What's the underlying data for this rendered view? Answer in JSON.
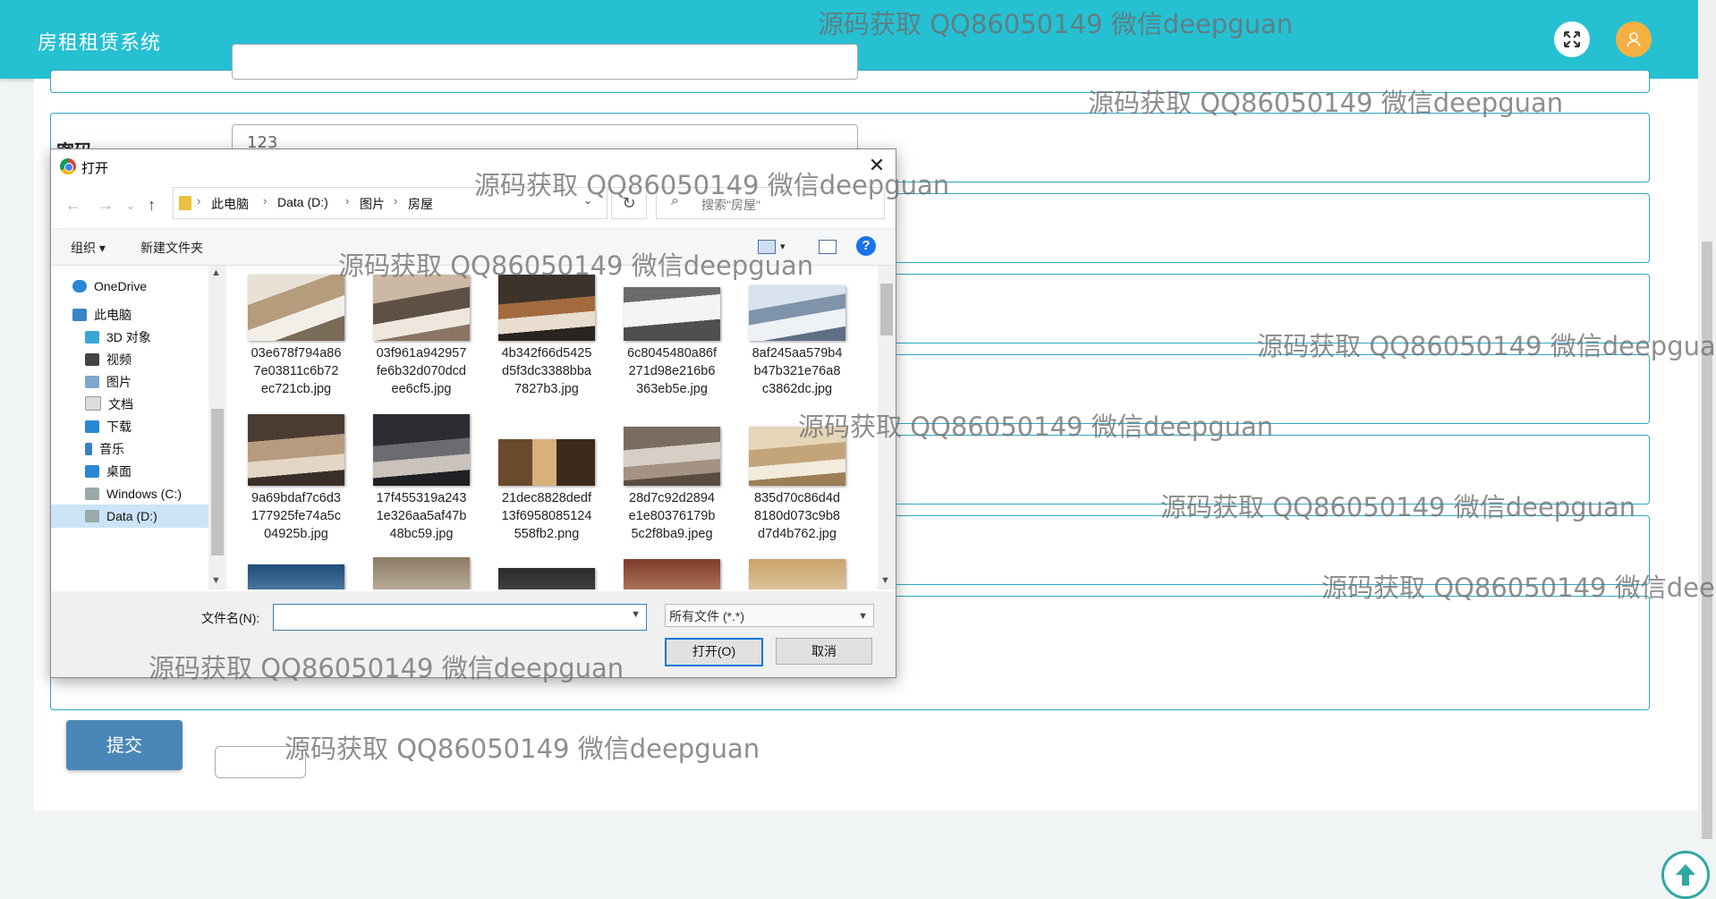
{
  "app": {
    "title": "房租租赁系统"
  },
  "form": {
    "password_label": "密码",
    "password_value": "123",
    "submit_label": "提交"
  },
  "dialog": {
    "title": "打开",
    "close_glyph": "✕",
    "path": [
      "此电脑",
      "Data (D:)",
      "图片",
      "房屋"
    ],
    "search_placeholder": "搜索\"房屋\"",
    "toolbar": {
      "organize": "组织 ▾",
      "new_folder": "新建文件夹"
    },
    "nav": [
      "OneDrive",
      "此电脑",
      "3D 对象",
      "视频",
      "图片",
      "文档",
      "下载",
      "音乐",
      "桌面",
      "Windows (C:)",
      "Data (D:)"
    ],
    "nav_selected": "Data (D:)",
    "files": [
      {
        "name": "03e678f794a867e03811c6b72ec721cb.jpg",
        "l1": "03e678f794a86",
        "l2": "7e03811c6b72",
        "l3": "ec721cb.jpg"
      },
      {
        "name": "03f961a942957fe6b32d070dcdee6cf5.jpg",
        "l1": "03f961a942957",
        "l2": "fe6b32d070dcd",
        "l3": "ee6cf5.jpg"
      },
      {
        "name": "4b342f66d5425d5f3dc3388bba7827b3.jpg",
        "l1": "4b342f66d5425",
        "l2": "d5f3dc3388bba",
        "l3": "7827b3.jpg"
      },
      {
        "name": "6c8045480a86f271d98e216b6363eb5e.jpg",
        "l1": "6c8045480a86f",
        "l2": "271d98e216b6",
        "l3": "363eb5e.jpg"
      },
      {
        "name": "8af245aa579b4b47b321e76a8c3862dc.jpg",
        "l1": "8af245aa579b4",
        "l2": "b47b321e76a8",
        "l3": "c3862dc.jpg"
      },
      {
        "name": "9a69bdaf7c6d3177925fe74a5c04925b.jpg",
        "l1": "9a69bdaf7c6d3",
        "l2": "177925fe74a5c",
        "l3": "04925b.jpg"
      },
      {
        "name": "17f455319a2431e326aa5af47b48bc59.jpg",
        "l1": "17f455319a243",
        "l2": "1e326aa5af47b",
        "l3": "48bc59.jpg"
      },
      {
        "name": "21dec8828dedf13f6958085124558fb2.png",
        "l1": "21dec8828dedf",
        "l2": "13f6958085124",
        "l3": "558fb2.png"
      },
      {
        "name": "28d7c92d2894e1e80376179b5c2f8ba9.jpeg",
        "l1": "28d7c92d2894",
        "l2": "e1e80376179b",
        "l3": "5c2f8ba9.jpeg"
      },
      {
        "name": "835d70c86d4d8180d073c9b8d7d4b762.jpg",
        "l1": "835d70c86d4d",
        "l2": "8180d073c9b8",
        "l3": "d7d4b762.jpg"
      }
    ],
    "filename_label": "文件名(N):",
    "filename_value": "",
    "filetype": "所有文件 (*.*)",
    "open_label": "打开(O)",
    "cancel_label": "取消"
  },
  "watermark": "源码获取 QQ86050149 微信deepguan",
  "colors": {
    "header": "#26c0d3",
    "submit": "#4a87b7",
    "border": "#2ea8c4"
  }
}
